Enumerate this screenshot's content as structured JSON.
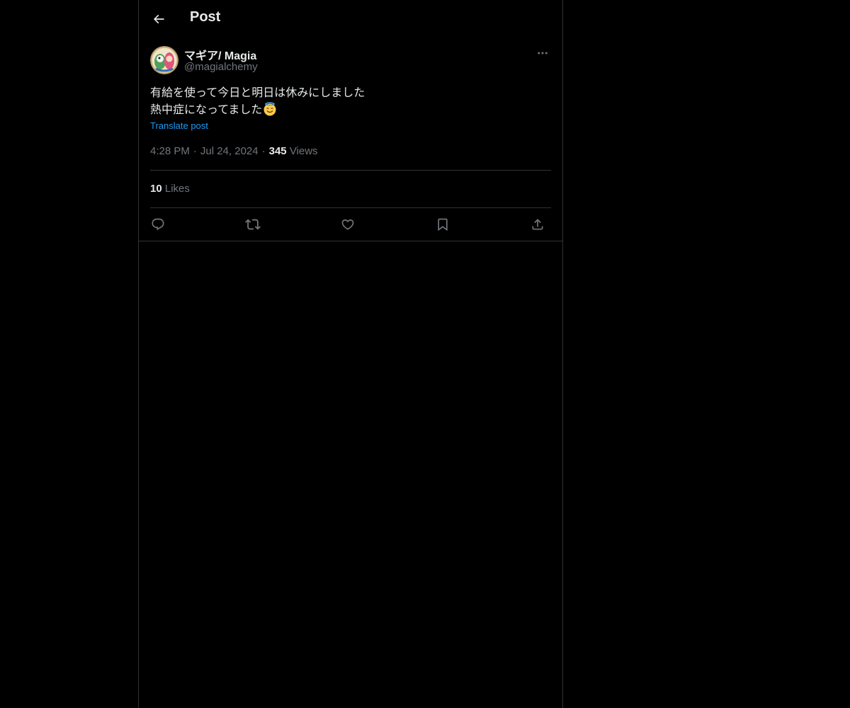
{
  "header": {
    "back_icon": "arrow-left-icon",
    "title": "Post"
  },
  "post": {
    "author": {
      "display_name": "マギア/ Magia",
      "handle": "@magialchemy",
      "avatar_icon": "avatar-image"
    },
    "more_icon": "more-horizontal-icon",
    "text_line1": "有給を使って今日と明日は休みにしました",
    "text_line2": "熱中症になってました",
    "emoji_icon": "smiling-face-with-halo-emoji",
    "translate_label": "Translate post",
    "time": "4:28 PM",
    "separator": "·",
    "date": "Jul 24, 2024",
    "views_count": "345",
    "views_label": "Views",
    "likes_count": "10",
    "likes_label": "Likes"
  },
  "actions": [
    {
      "icon": "reply-icon"
    },
    {
      "icon": "repost-icon"
    },
    {
      "icon": "like-icon"
    },
    {
      "icon": "bookmark-icon"
    },
    {
      "icon": "share-icon"
    }
  ],
  "colors": {
    "background": "#000000",
    "text": "#e7e9ea",
    "secondary_text": "#71767b",
    "link": "#1d9bf0",
    "border": "#2f3336"
  }
}
